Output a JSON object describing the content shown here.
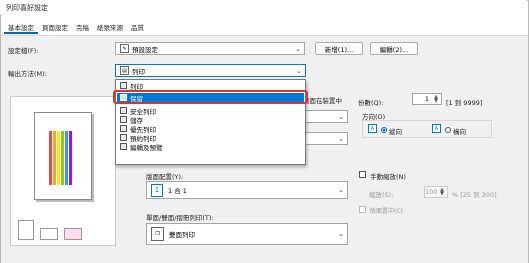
{
  "window": {
    "title": "列印喜好設定"
  },
  "tabs": [
    "基本設定",
    "頁面設定",
    "完稿",
    "紙張來源",
    "品質"
  ],
  "profile": {
    "label": "設定檔(F):",
    "value": "預設設定",
    "add_button": "新增(1)...",
    "edit_button": "編輯(2)..."
  },
  "output": {
    "label": "輸出方法(M):",
    "value": "列印"
  },
  "dropdown": {
    "items": [
      {
        "label": "列印",
        "selected": false
      },
      {
        "label": "保留",
        "selected": true
      },
      {
        "label": "安全列印",
        "selected": false
      },
      {
        "label": "儲存",
        "selected": false
      },
      {
        "label": "優先列印",
        "selected": false
      },
      {
        "label": "預約列印",
        "selected": false
      },
      {
        "label": "編輯及預覽",
        "selected": false
      }
    ]
  },
  "hidden_text": "頁面在裝置中",
  "copies": {
    "label": "份數(Q):",
    "value": "1",
    "range": "[1 到 9999]"
  },
  "orientation": {
    "label": "方向(O)",
    "portrait": "縱向",
    "landscape": "橫向"
  },
  "page_layout": {
    "label": "版面配置(Y):",
    "value": "1 合 1"
  },
  "manual_scaling": {
    "label": "手動縮放(N)",
    "scale_label": "縮放(S):",
    "scale_value": "100",
    "scale_range": "% [25 到 200]",
    "center_label": "版面置中(C)"
  },
  "duplex": {
    "label": "單面/雙面/摺冊列印(T):",
    "value": "雙面列印"
  },
  "colors": {
    "accent": "#0078d7",
    "highlight": "#e0312b"
  }
}
